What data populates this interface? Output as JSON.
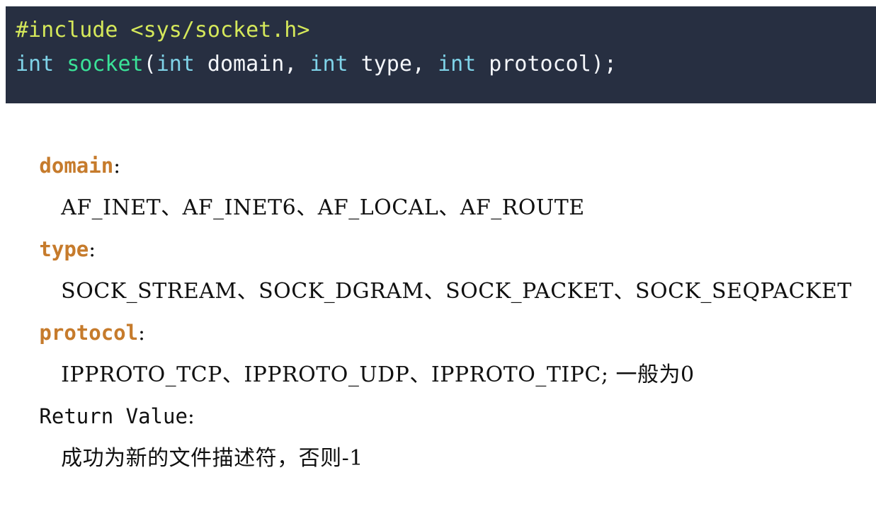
{
  "code_block": {
    "background_color": "#272f41",
    "lines": [
      {
        "id": "include-line",
        "tokens": [
          {
            "kind": "preproc",
            "text": "#include <sys/socket.h>"
          }
        ]
      },
      {
        "id": "signature-line",
        "tokens": [
          {
            "kind": "keyword",
            "text": "int"
          },
          {
            "kind": "plain",
            "text": " "
          },
          {
            "kind": "func",
            "text": "socket"
          },
          {
            "kind": "plain",
            "text": "("
          },
          {
            "kind": "keyword",
            "text": "int"
          },
          {
            "kind": "plain",
            "text": " domain, "
          },
          {
            "kind": "keyword",
            "text": "int"
          },
          {
            "kind": "plain",
            "text": " type, "
          },
          {
            "kind": "keyword",
            "text": "int"
          },
          {
            "kind": "plain",
            "text": " protocol);"
          }
        ]
      }
    ],
    "colors": {
      "preproc": "#d5e85a",
      "keyword": "#7fd3e8",
      "func": "#3ae298",
      "plain": "#f4f6fa"
    }
  },
  "doc": {
    "accent_color": "#c67b2c",
    "sections": [
      {
        "label_key": "domain",
        "label_colon": ":",
        "label_is_accent": true,
        "value": "AF_INET、AF_INET6、AF_LOCAL、AF_ROUTE"
      },
      {
        "label_key": "type",
        "label_colon": ":",
        "label_is_accent": true,
        "value": "SOCK_STREAM、SOCK_DGRAM、SOCK_PACKET、SOCK_SEQPACKET"
      },
      {
        "label_key": "protocol",
        "label_colon": ":",
        "label_is_accent": true,
        "value": "IPPROTO_TCP、IPPROTO_UDP、IPPROTO_TIPC; 一般为0"
      },
      {
        "label_key": "Return Value",
        "label_colon": ":",
        "label_is_accent": false,
        "value": "成功为新的文件描述符，否则-1"
      }
    ]
  },
  "watermark": {
    "text": ""
  }
}
